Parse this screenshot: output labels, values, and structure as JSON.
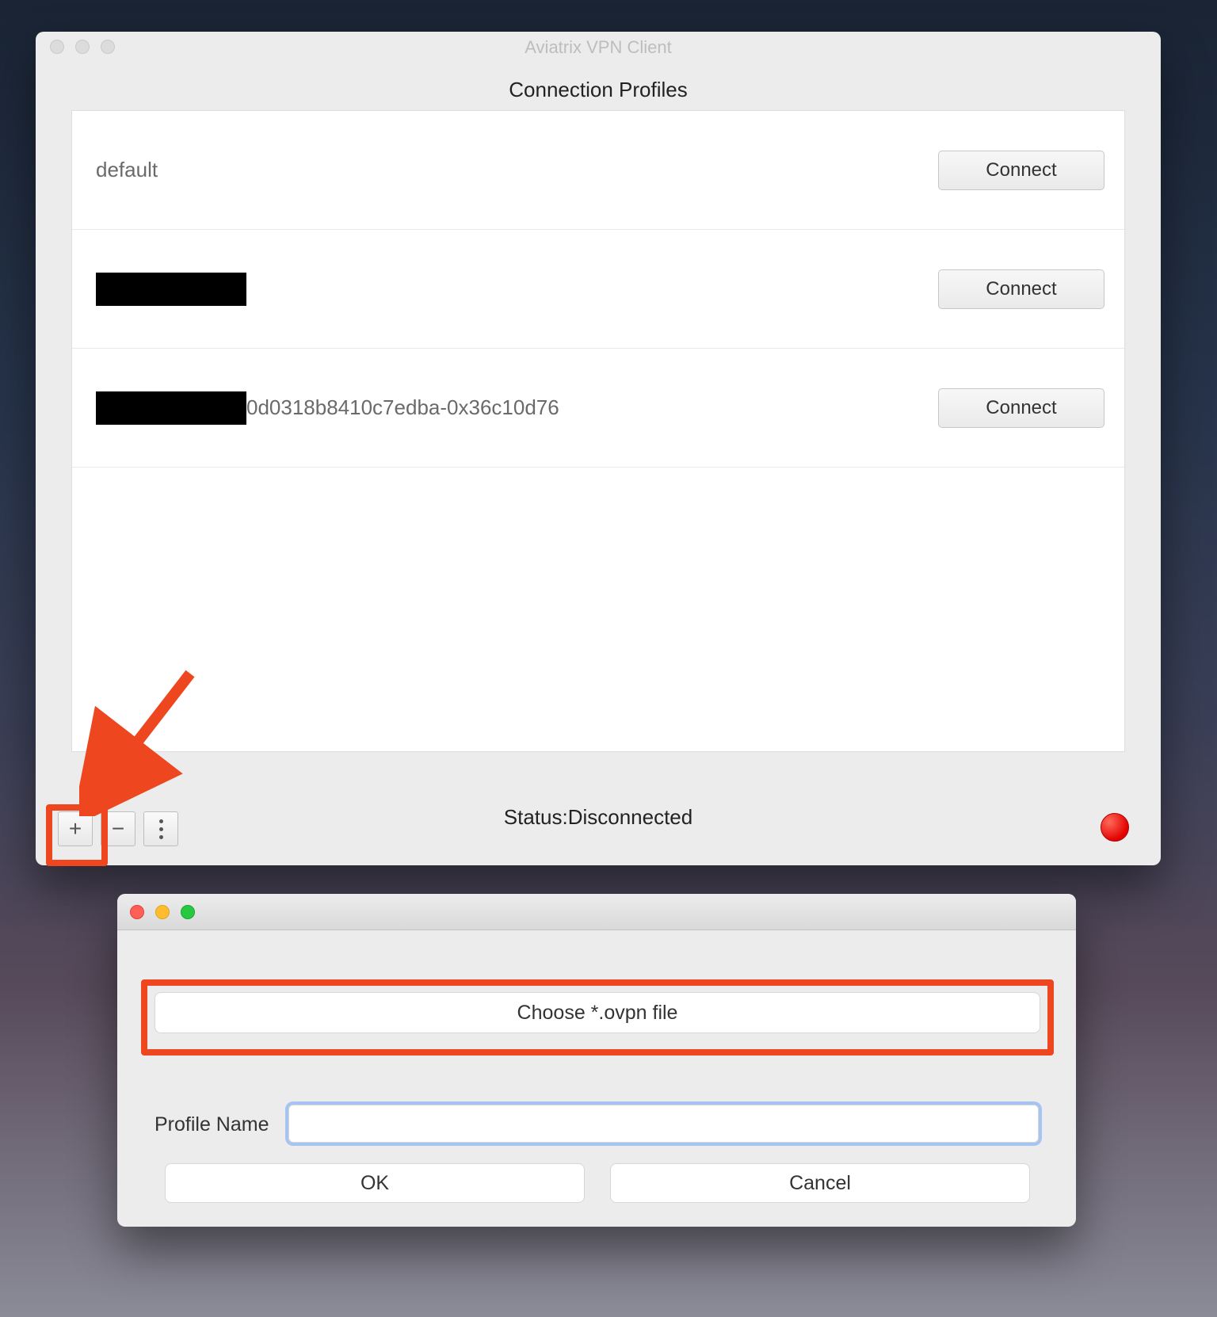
{
  "mainWindow": {
    "title": "Aviatrix VPN Client",
    "sectionTitle": "Connection Profiles",
    "profiles": [
      {
        "name": "default",
        "redactedPrefix": false,
        "connectLabel": "Connect"
      },
      {
        "name": "",
        "redactedPrefix": true,
        "connectLabel": "Connect"
      },
      {
        "name": "0d0318b8410c7edba-0x36c10d76",
        "redactedPrefix": true,
        "connectLabel": "Connect"
      }
    ],
    "statusLabel": "Status:",
    "statusValue": "Disconnected",
    "statusColor": "#e20000",
    "toolbar": {
      "add": "+",
      "remove": "−",
      "more": "⋮"
    }
  },
  "dialog": {
    "chooseFileLabel": "Choose *.ovpn file",
    "profileNameLabel": "Profile Name",
    "profileNameValue": "",
    "okLabel": "OK",
    "cancelLabel": "Cancel"
  },
  "annotations": {
    "plusBox": true,
    "chooseBox": true
  }
}
